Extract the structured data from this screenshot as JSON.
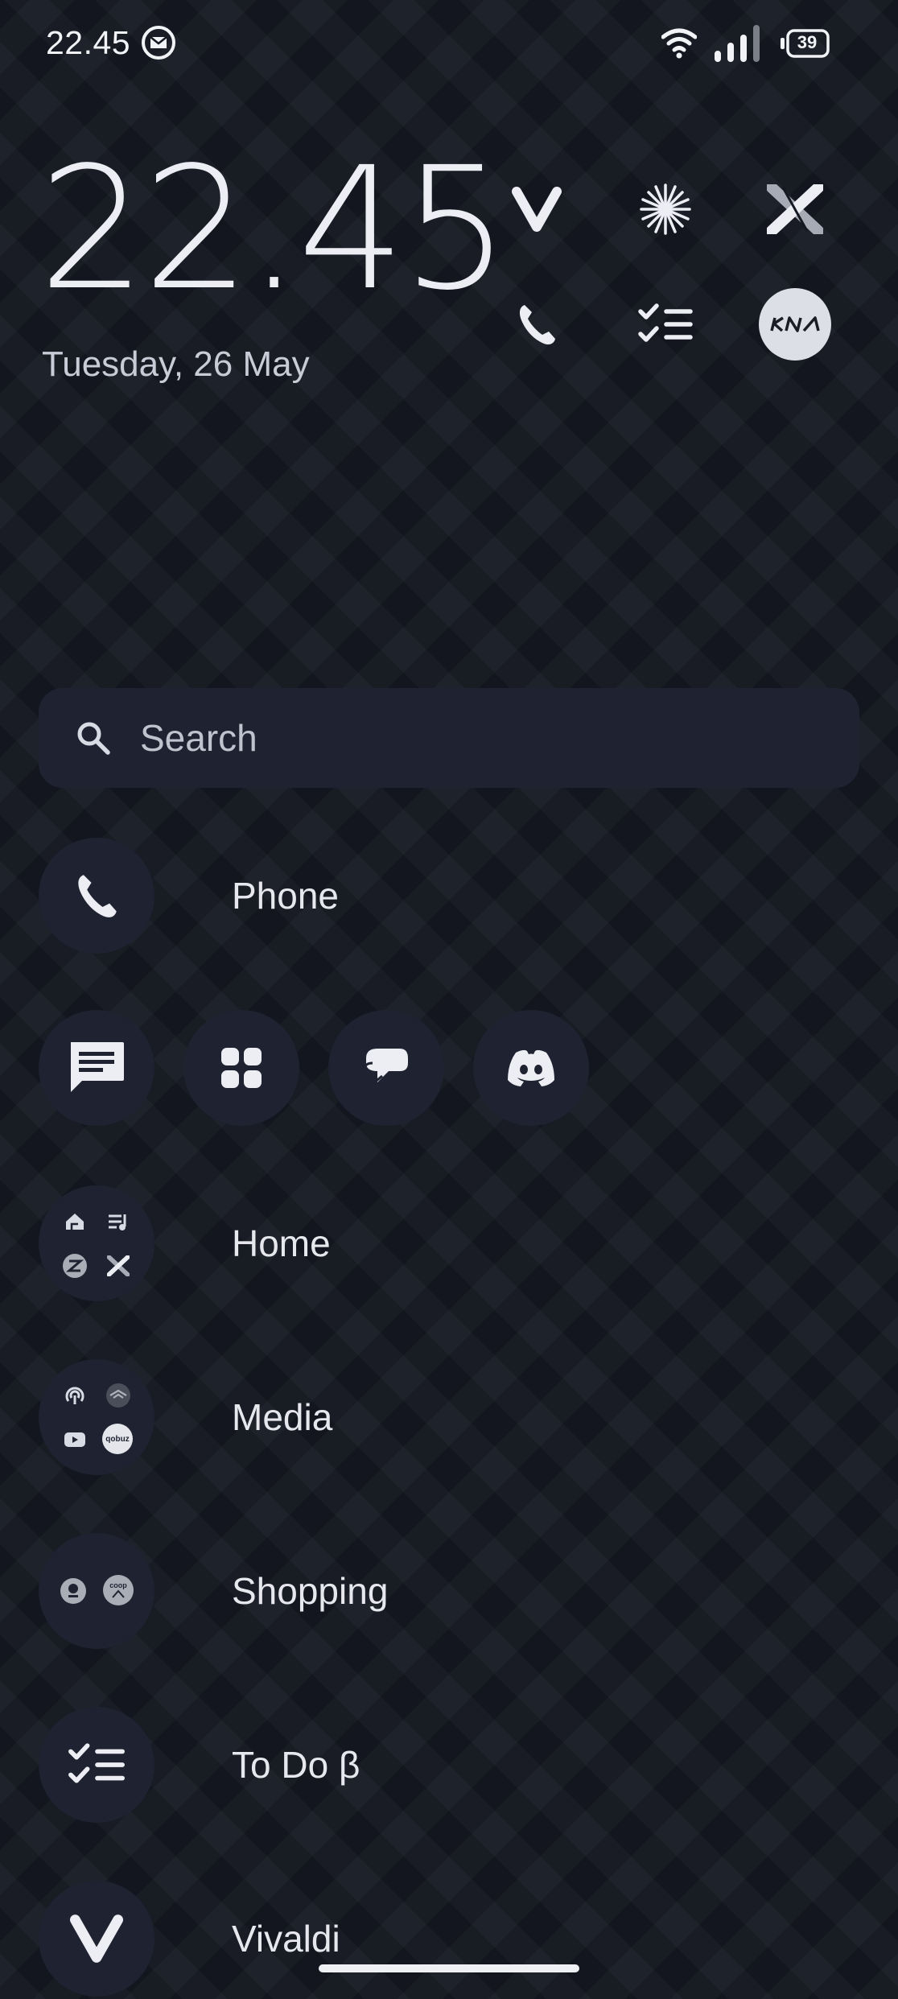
{
  "status_bar": {
    "time": "22.45",
    "battery": "39",
    "icons": [
      "mail-notification-icon",
      "wifi-icon",
      "signal-icon",
      "battery-icon"
    ]
  },
  "clock": {
    "time": "22.45",
    "date": "Tuesday, 26 May"
  },
  "shortcuts": [
    {
      "name": "vivaldi-shortcut",
      "icon": "vivaldi-icon"
    },
    {
      "name": "starburst-shortcut",
      "icon": "starburst-icon"
    },
    {
      "name": "x-app-shortcut",
      "icon": "x-icon"
    },
    {
      "name": "phone-shortcut",
      "icon": "phone-icon"
    },
    {
      "name": "todo-shortcut",
      "icon": "checklist-icon"
    },
    {
      "name": "kia-shortcut",
      "icon": "kia-icon",
      "label": "KIA"
    }
  ],
  "search": {
    "placeholder": "Search"
  },
  "apps": {
    "phone": "Phone",
    "home": "Home",
    "media": "Media",
    "shopping": "Shopping",
    "todo": "To Do β",
    "vivaldi": "Vivaldi"
  },
  "media_folder": {
    "qobuz_label": "qobuz"
  },
  "shopping_folder": {
    "coop_label": "coop"
  },
  "colors": {
    "background": "#151821",
    "surface": "#1f2230",
    "text": "#e6e8ee",
    "icon": "#e8eaf0"
  }
}
